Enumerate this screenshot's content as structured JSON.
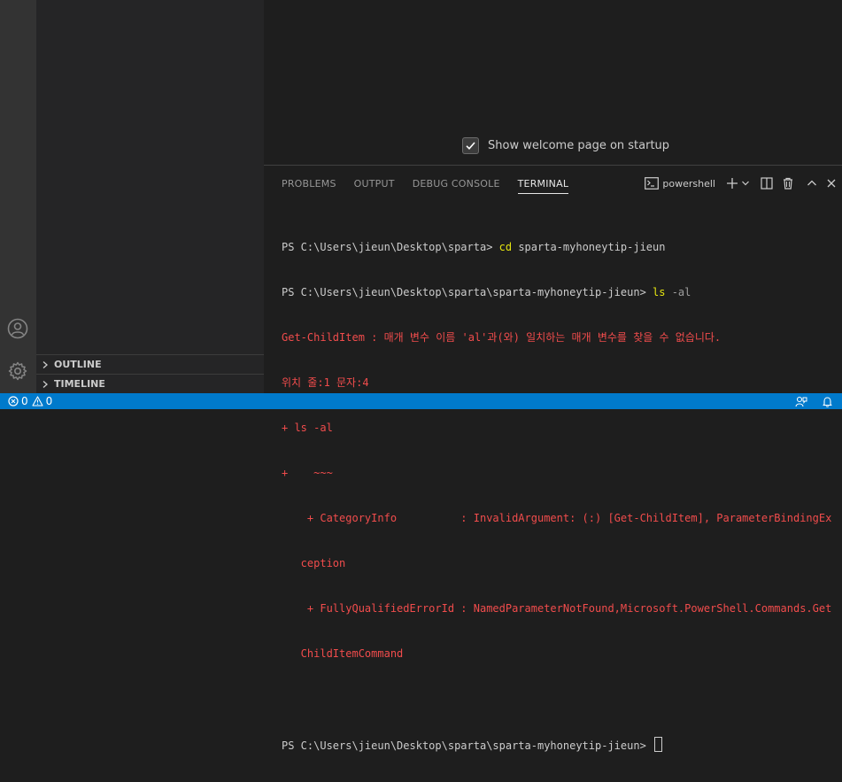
{
  "activity_bar": {
    "icons": [
      "account-icon",
      "manage-gear-icon"
    ]
  },
  "sidebar": {
    "sections": [
      {
        "label": "OUTLINE"
      },
      {
        "label": "TIMELINE"
      }
    ]
  },
  "editor": {
    "welcome_checkbox_label": "Show welcome page on startup",
    "welcome_checkbox_checked": true
  },
  "panel": {
    "tabs": [
      {
        "label": "PROBLEMS"
      },
      {
        "label": "OUTPUT"
      },
      {
        "label": "DEBUG CONSOLE"
      },
      {
        "label": "TERMINAL",
        "active": true
      }
    ],
    "shell_label": "powershell"
  },
  "terminal": {
    "line1_prompt": "PS C:\\Users\\jieun\\Desktop\\sparta> ",
    "line1_cmd": "cd",
    "line1_arg": " sparta-myhoneytip-jieun",
    "line2_prompt": "PS C:\\Users\\jieun\\Desktop\\sparta\\sparta-myhoneytip-jieun> ",
    "line2_cmd": "ls",
    "line2_arg": " -al",
    "err1": "Get-ChildItem : 매개 변수 이름 'al'과(와) 일치하는 매개 변수를 찾을 수 없습니다.",
    "err2": "위치 줄:1 문자:4",
    "err3": "+ ls -al",
    "err4": "+    ~~~",
    "err5": "    + CategoryInfo          : InvalidArgument: (:) [Get-ChildItem], ParameterBindingEx",
    "err6": "   ception",
    "err7": "    + FullyQualifiedErrorId : NamedParameterNotFound,Microsoft.PowerShell.Commands.Get",
    "err8": "   ChildItemCommand",
    "final_prompt": "PS C:\\Users\\jieun\\Desktop\\sparta\\sparta-myhoneytip-jieun> "
  },
  "status_bar": {
    "errors_count": "0",
    "warnings_count": "0",
    "colors": {
      "background": "#007acc"
    }
  }
}
